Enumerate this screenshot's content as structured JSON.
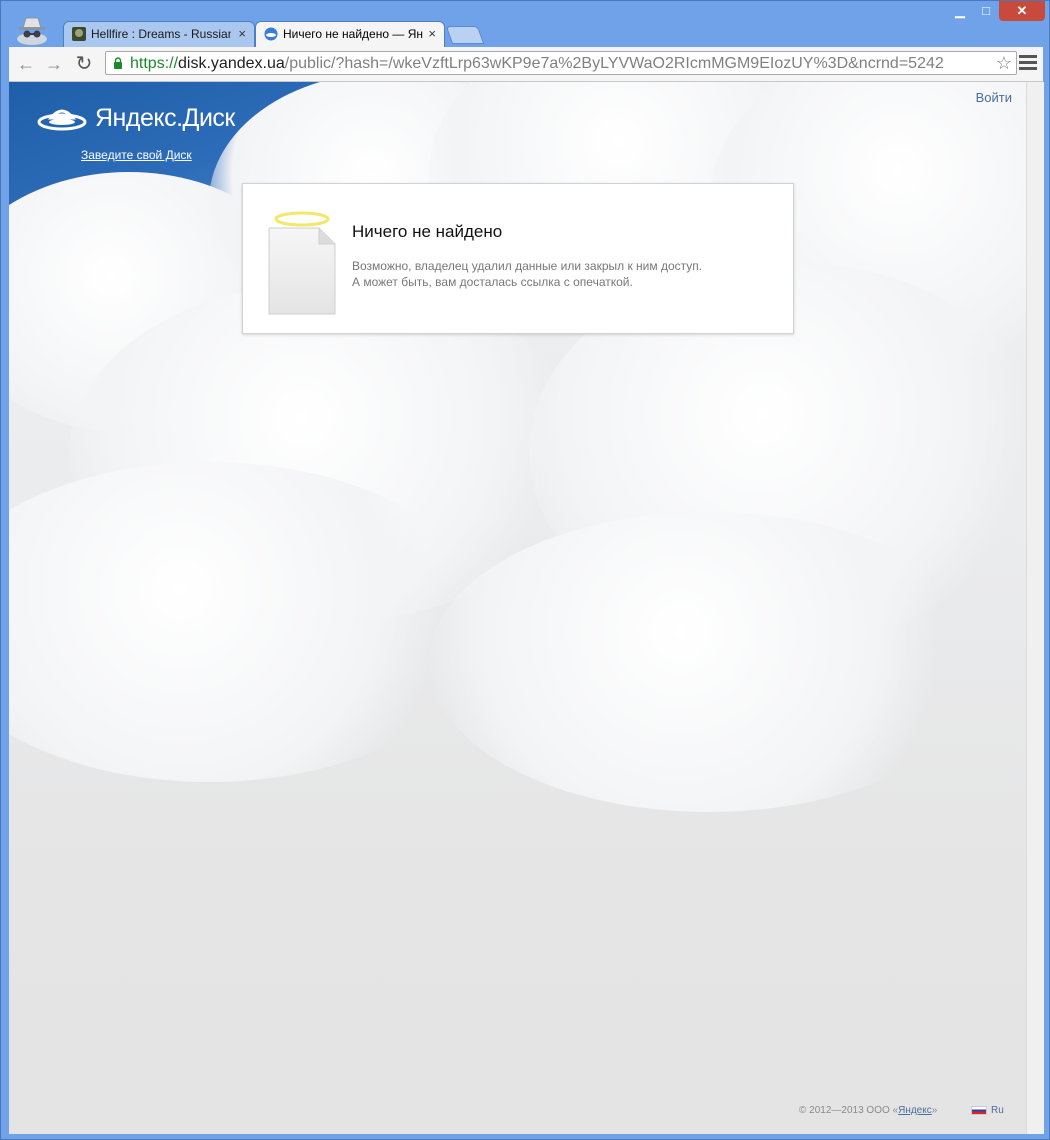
{
  "browser": {
    "tabs": [
      {
        "title": "Hellfire : Dreams - Russian",
        "close": "×",
        "active": false
      },
      {
        "title": "Ничего не найдено — Яндекс.Диск",
        "close": "×",
        "active": true
      }
    ],
    "window_buttons": {
      "minimize": "▁",
      "maximize": "□",
      "close": "✕"
    },
    "nav": {
      "back": "←",
      "forward": "→",
      "reload": "↻"
    },
    "url": {
      "scheme": "https://",
      "host": "disk.yandex.ua",
      "path": "/public/?hash=/wkeVzftLrp63wKP9e7a%2ByLYVWaO2RIcmMGM9EIozUY%3D&ncrnd=5242"
    },
    "star": "☆"
  },
  "header": {
    "logo_text": "Яндекс.Диск",
    "create_disk_link": "Заведите свой Диск",
    "login_link": "Войти"
  },
  "message": {
    "title": "Ничего не найдено",
    "line1": "Возможно, владелец удалил данные или закрыл к ним доступ.",
    "line2": "А может быть, вам досталась ссылка с опечаткой."
  },
  "footer": {
    "copyright_prefix": "© 2012—2013 ООО «",
    "company_link": "Яндекс",
    "copyright_suffix": "»",
    "language": "Ru"
  },
  "colors": {
    "sky_blue": "#2d6cb8",
    "link_blue": "#4a6e9e",
    "secure_green": "#1c8a2c",
    "window_frame": "#6fa2e8"
  }
}
